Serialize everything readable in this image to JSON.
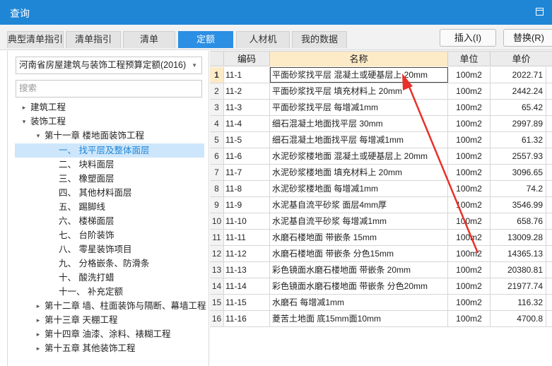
{
  "window": {
    "title": "查询"
  },
  "tabs": [
    {
      "label": "典型清单指引",
      "active": false
    },
    {
      "label": "清单指引",
      "active": false
    },
    {
      "label": "清单",
      "active": false
    },
    {
      "label": "定额",
      "active": true
    },
    {
      "label": "人材机",
      "active": false
    },
    {
      "label": "我的数据",
      "active": false
    }
  ],
  "toolbar": {
    "insert_label": "插入(I)",
    "replace_label": "替换(R)"
  },
  "left": {
    "dropdown_value": "河南省房屋建筑与装饰工程预算定额(2016)",
    "search_placeholder": "搜索",
    "tree": [
      {
        "label": "建筑工程",
        "toggle": "▸",
        "expanded": false
      },
      {
        "label": "装饰工程",
        "toggle": "▾",
        "expanded": true
      },
      {
        "label": "第十一章 楼地面装饰工程",
        "toggle": "▾",
        "expanded": true
      },
      {
        "label": "一、 找平层及整体面层",
        "selected": true
      },
      {
        "label": "二、 块料面层"
      },
      {
        "label": "三、 橡塑面层"
      },
      {
        "label": "四、 其他材料面层"
      },
      {
        "label": "五、 踢脚线"
      },
      {
        "label": "六、 楼梯面层"
      },
      {
        "label": "七、 台阶装饰"
      },
      {
        "label": "八、 零星装饰项目"
      },
      {
        "label": "九、 分格嵌条、防滑条"
      },
      {
        "label": "十、 酸洗打蜡"
      },
      {
        "label": "十一、 补充定额"
      },
      {
        "label": "第十二章 墙、柱面装饰与隔断、幕墙工程",
        "toggle": "▸"
      },
      {
        "label": "第十三章 天棚工程",
        "toggle": "▸"
      },
      {
        "label": "第十四章 油漆、涂料、裱糊工程",
        "toggle": "▸"
      },
      {
        "label": "第十五章 其他装饰工程",
        "toggle": "▸"
      }
    ]
  },
  "grid": {
    "columns": [
      "编码",
      "名称",
      "单位",
      "单价"
    ],
    "rows": [
      {
        "no": "1",
        "code": "11-1",
        "name": "平面砂浆找平层 混凝土或硬基层上 20mm",
        "unit": "100m2",
        "price": "2022.71"
      },
      {
        "no": "2",
        "code": "11-2",
        "name": "平面砂浆找平层 填充材料上 20mm",
        "unit": "100m2",
        "price": "2442.24"
      },
      {
        "no": "3",
        "code": "11-3",
        "name": "平面砂浆找平层 每增减1mm",
        "unit": "100m2",
        "price": "65.42"
      },
      {
        "no": "4",
        "code": "11-4",
        "name": "细石混凝土地面找平层 30mm",
        "unit": "100m2",
        "price": "2997.89"
      },
      {
        "no": "5",
        "code": "11-5",
        "name": "细石混凝土地面找平层 每增减1mm",
        "unit": "100m2",
        "price": "61.32"
      },
      {
        "no": "6",
        "code": "11-6",
        "name": "水泥砂浆楼地面 混凝土或硬基层上 20mm",
        "unit": "100m2",
        "price": "2557.93"
      },
      {
        "no": "7",
        "code": "11-7",
        "name": "水泥砂浆楼地面 填充材料上 20mm",
        "unit": "100m2",
        "price": "3096.65"
      },
      {
        "no": "8",
        "code": "11-8",
        "name": "水泥砂浆楼地面 每增减1mm",
        "unit": "100m2",
        "price": "74.2"
      },
      {
        "no": "9",
        "code": "11-9",
        "name": "水泥基自流平砂浆 面层4mm厚",
        "unit": "100m2",
        "price": "3546.99"
      },
      {
        "no": "10",
        "code": "11-10",
        "name": "水泥基自流平砂浆 每增减1mm",
        "unit": "100m2",
        "price": "658.76"
      },
      {
        "no": "11",
        "code": "11-11",
        "name": "水磨石楼地面 带嵌条 15mm",
        "unit": "100m2",
        "price": "13009.28"
      },
      {
        "no": "12",
        "code": "11-12",
        "name": "水磨石楼地面 带嵌条 分色15mm",
        "unit": "100m2",
        "price": "14365.13"
      },
      {
        "no": "13",
        "code": "11-13",
        "name": "彩色镜面水磨石楼地面 带嵌条 20mm",
        "unit": "100m2",
        "price": "20380.81"
      },
      {
        "no": "14",
        "code": "11-14",
        "name": "彩色镜面水磨石楼地面 带嵌条 分色20mm",
        "unit": "100m2",
        "price": "21977.74"
      },
      {
        "no": "15",
        "code": "11-15",
        "name": "水磨石 每增减1mm",
        "unit": "100m2",
        "price": "116.32"
      },
      {
        "no": "16",
        "code": "11-16",
        "name": "菱苦土地面 底15mm面10mm",
        "unit": "100m2",
        "price": "4700.8"
      }
    ]
  },
  "colors": {
    "accent": "#1f86d6",
    "active_tab": "#2b8fe3",
    "selected_node": "#cde6fb",
    "header_highlight": "#fdebc8",
    "annotation_arrow": "#e8302a"
  }
}
